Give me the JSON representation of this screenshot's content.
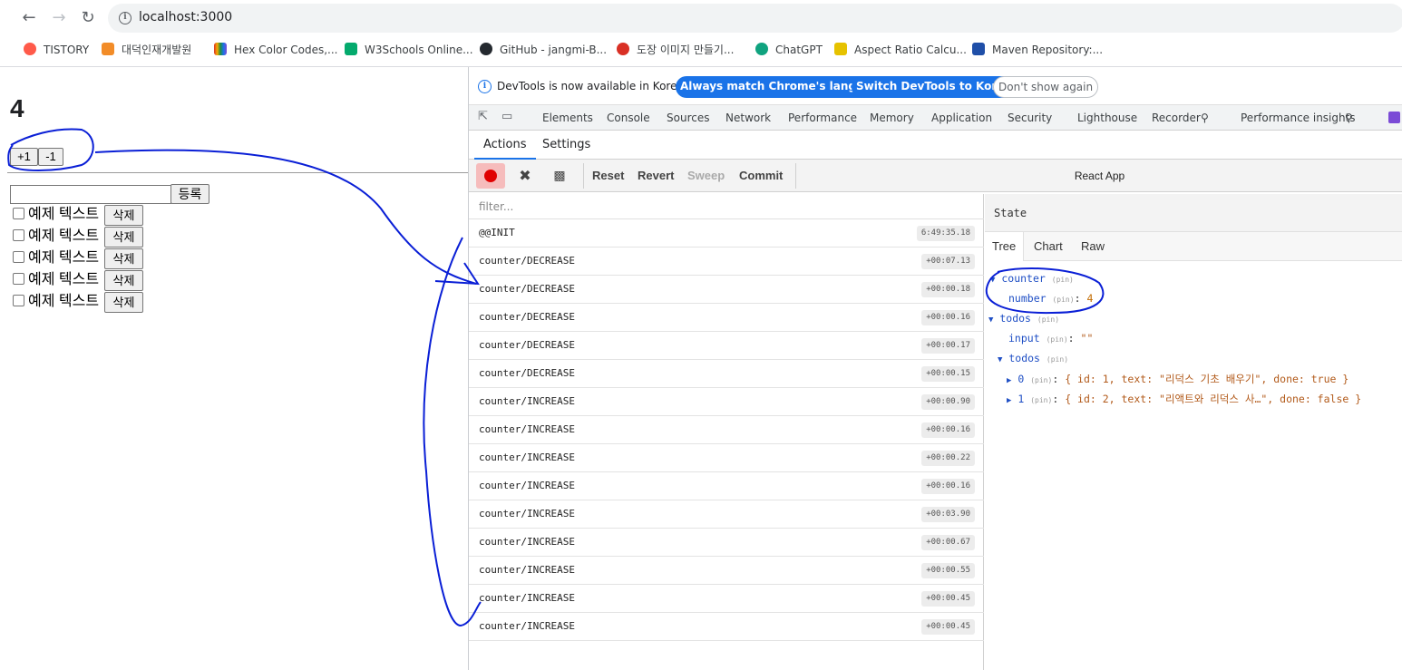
{
  "browser": {
    "url": "localhost:3000",
    "bookmarks": [
      {
        "label": "TISTORY",
        "color": "#ff5a4a"
      },
      {
        "label": "대덕인재개발원",
        "color": "#f28c28"
      },
      {
        "label": "Hex Color Codes,...",
        "color": "#7b4bd6"
      },
      {
        "label": "W3Schools Online...",
        "color": "#04aa6d"
      },
      {
        "label": "GitHub - jangmi-B...",
        "color": "#24292f"
      },
      {
        "label": "도장 이미지 만들기...",
        "color": "#d93025"
      },
      {
        "label": "ChatGPT",
        "color": "#10a37f"
      },
      {
        "label": "Aspect Ratio Calcu...",
        "color": "#e6c200"
      },
      {
        "label": "Maven Repository:...",
        "color": "#1f4fa8"
      }
    ]
  },
  "page": {
    "counter_value": "4",
    "plus_label": "+1",
    "minus_label": "-1",
    "submit_label": "등록",
    "todos": [
      {
        "text": "예제 텍스트",
        "delete_label": "삭제"
      },
      {
        "text": "예제 텍스트",
        "delete_label": "삭제"
      },
      {
        "text": "예제 텍스트",
        "delete_label": "삭제"
      },
      {
        "text": "예제 텍스트",
        "delete_label": "삭제"
      },
      {
        "text": "예제 텍스트",
        "delete_label": "삭제"
      }
    ]
  },
  "devtools": {
    "banner_text": "DevTools is now available in Korean!",
    "banner_btn1": "Always match Chrome's language",
    "banner_btn2": "Switch DevTools to Korean",
    "banner_btn3": "Don't show again",
    "tabs": [
      "Elements",
      "Console",
      "Sources",
      "Network",
      "Performance",
      "Memory",
      "Application",
      "Security",
      "Lighthouse",
      "Recorder",
      "Performance insights"
    ],
    "subtabs": [
      "Actions",
      "Settings"
    ],
    "toolbar": {
      "reset": "Reset",
      "revert": "Revert",
      "sweep": "Sweep",
      "commit": "Commit",
      "instance": "React App"
    },
    "filter_placeholder": "filter...",
    "actions": [
      {
        "name": "@@INIT",
        "time": "6:49:35.18"
      },
      {
        "name": "counter/DECREASE",
        "time": "+00:07.13"
      },
      {
        "name": "counter/DECREASE",
        "time": "+00:00.18"
      },
      {
        "name": "counter/DECREASE",
        "time": "+00:00.16"
      },
      {
        "name": "counter/DECREASE",
        "time": "+00:00.17"
      },
      {
        "name": "counter/DECREASE",
        "time": "+00:00.15"
      },
      {
        "name": "counter/INCREASE",
        "time": "+00:00.90"
      },
      {
        "name": "counter/INCREASE",
        "time": "+00:00.16"
      },
      {
        "name": "counter/INCREASE",
        "time": "+00:00.22"
      },
      {
        "name": "counter/INCREASE",
        "time": "+00:00.16"
      },
      {
        "name": "counter/INCREASE",
        "time": "+00:03.90"
      },
      {
        "name": "counter/INCREASE",
        "time": "+00:00.67"
      },
      {
        "name": "counter/INCREASE",
        "time": "+00:00.55"
      },
      {
        "name": "counter/INCREASE",
        "time": "+00:00.45"
      },
      {
        "name": "counter/INCREASE",
        "time": "+00:00.45"
      }
    ],
    "state": {
      "header": "State",
      "tabs": [
        "Tree",
        "Chart",
        "Raw"
      ],
      "pin": "(pin)",
      "counter_key": "counter",
      "number_key": "number",
      "number_value": "4",
      "todos_key": "todos",
      "input_key": "input",
      "input_value": "\"\"",
      "todos_inner_key": "todos",
      "item0_key": "0",
      "item0_value": "{ id: 1, text: \"리덕스 기초 배우기\", done: true }",
      "item1_key": "1",
      "item1_value": "{ id: 2, text: \"리액트와 리덕스 사…\", done: false }"
    }
  },
  "colors": {
    "accent": "#1a73e8",
    "annotation": "#0a1fd6",
    "record": "#e00000"
  }
}
